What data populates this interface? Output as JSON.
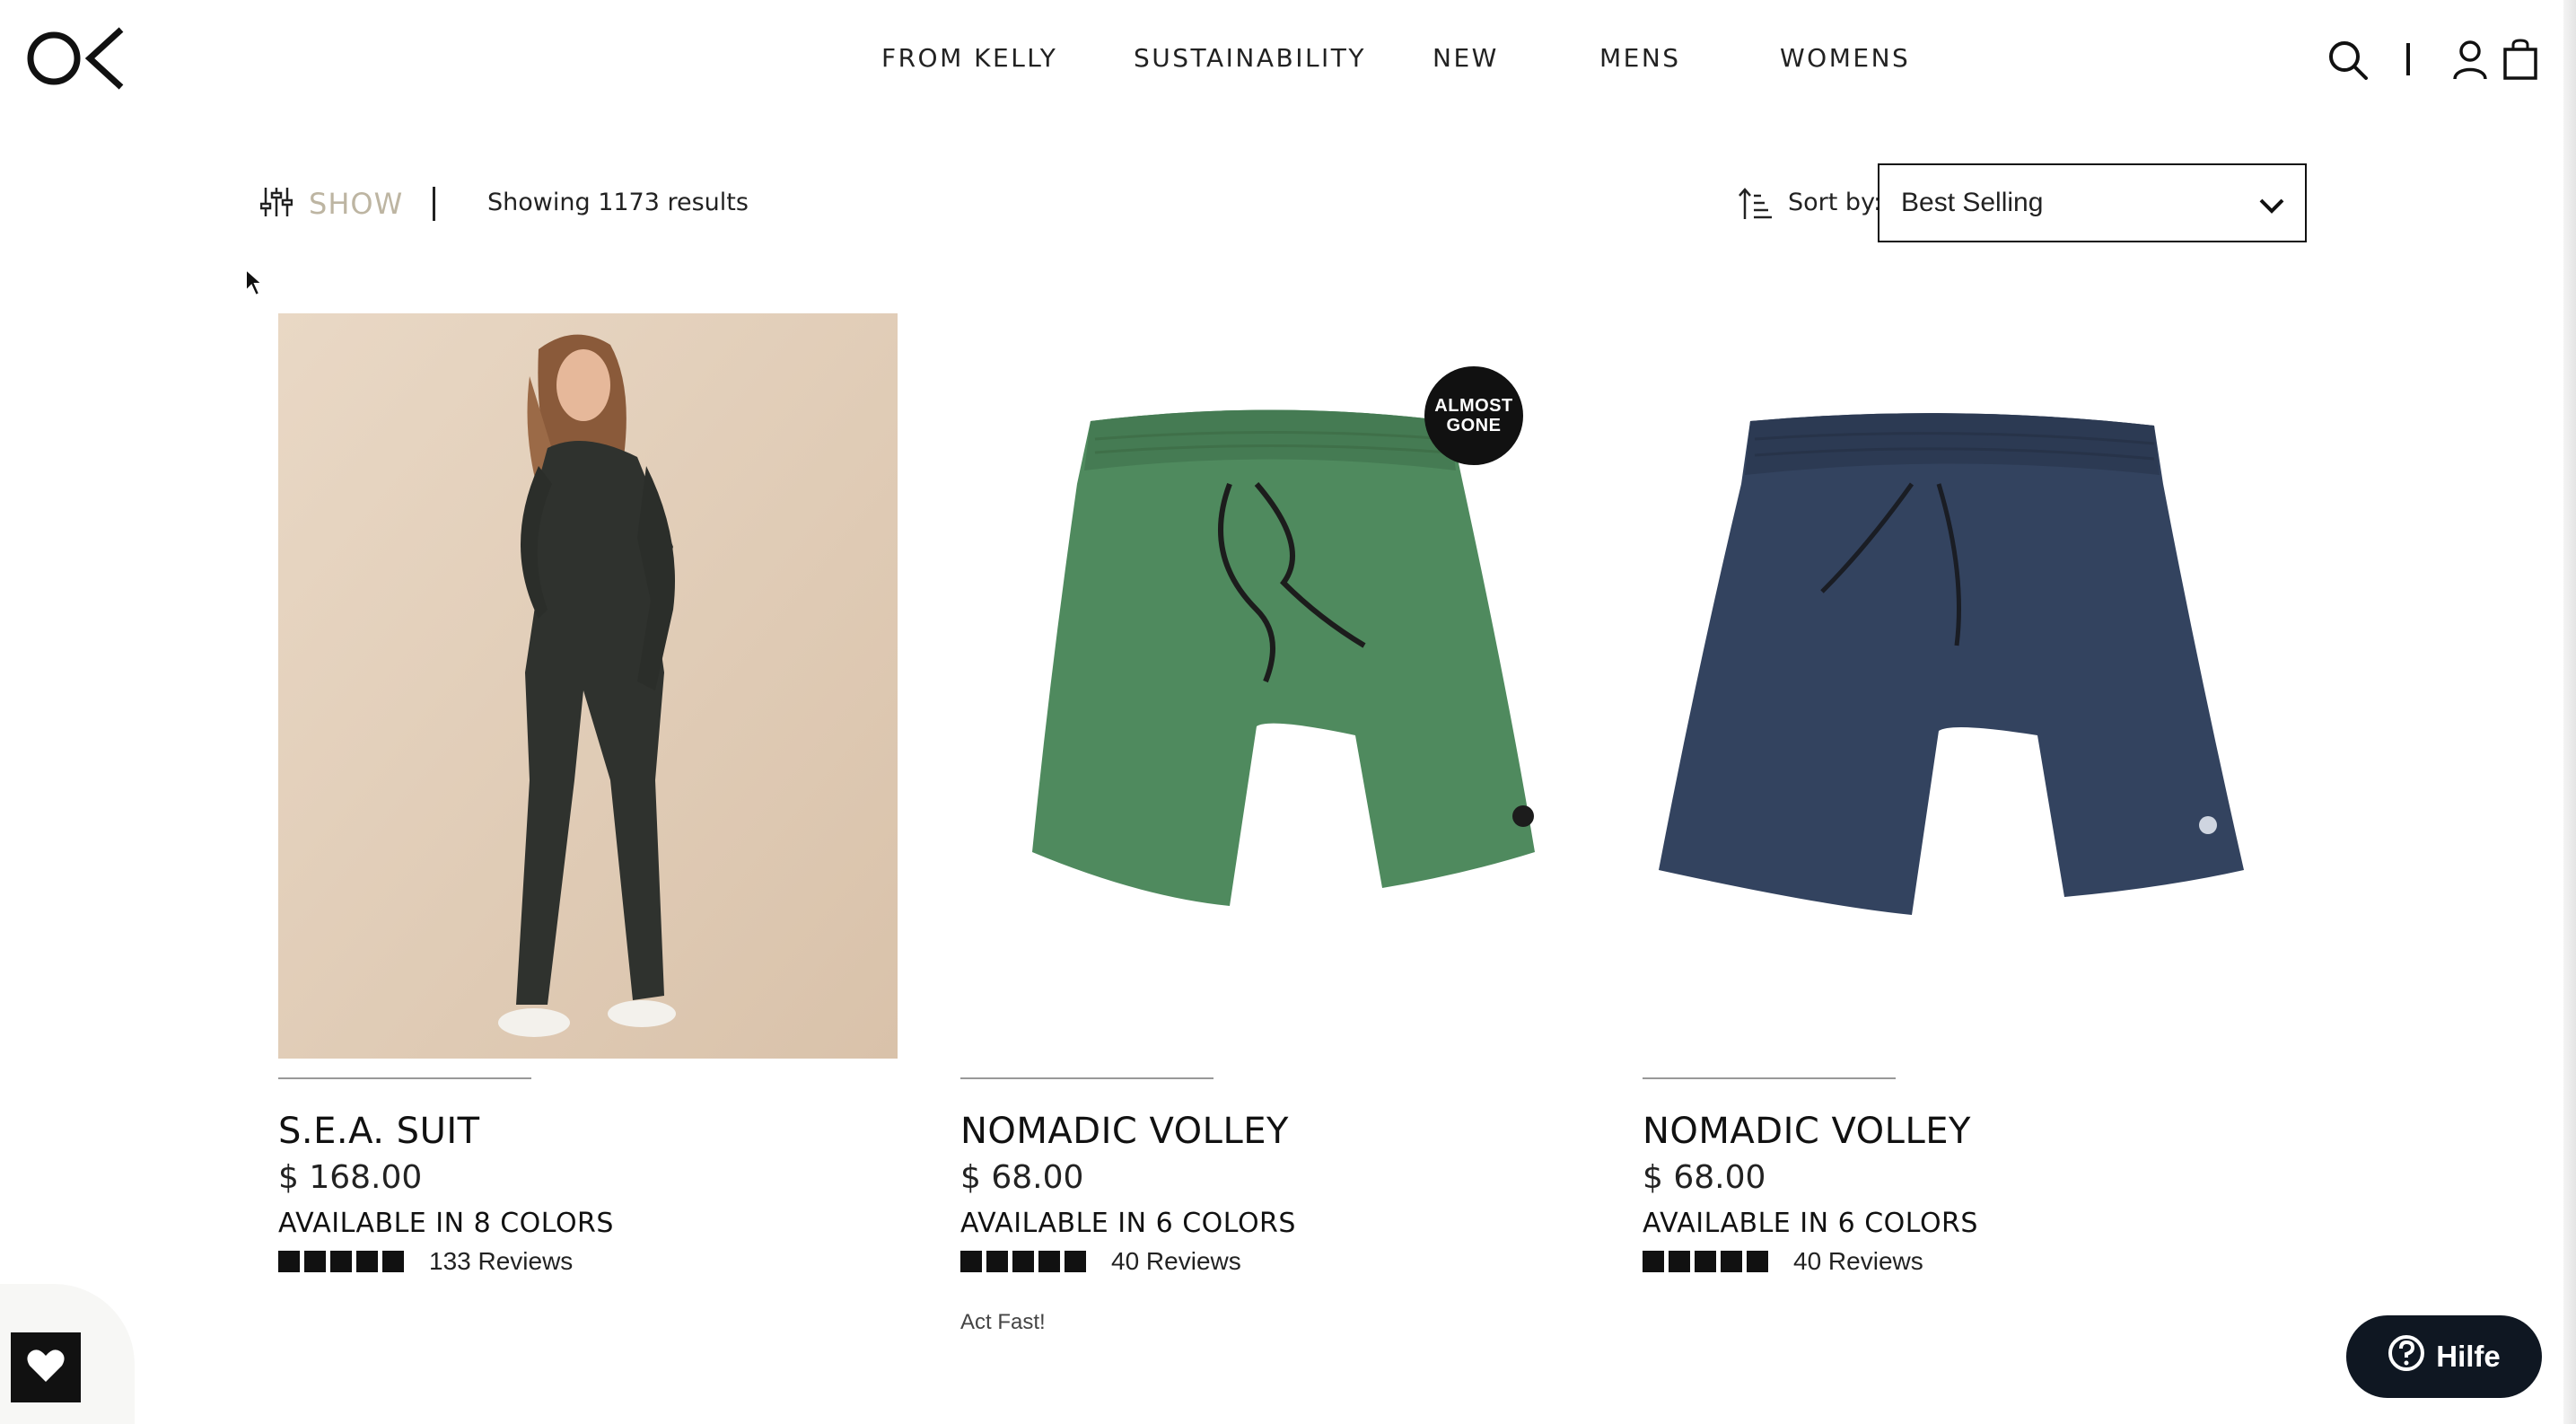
{
  "header": {
    "logo_alt": "OK",
    "nav": [
      {
        "label": "FROM KELLY"
      },
      {
        "label": "SUSTAINABILITY"
      },
      {
        "label": "NEW"
      },
      {
        "label": "MENS"
      },
      {
        "label": "WOMENS"
      }
    ],
    "icons": [
      "search-icon",
      "divider",
      "account-icon",
      "cart-icon"
    ]
  },
  "toolbar": {
    "show_label": "SHOW",
    "results_text": "Showing 1173 results",
    "sort_label": "Sort by:",
    "sort_value": "Best Selling"
  },
  "products": [
    {
      "name": "S.E.A. SUIT",
      "price": "$ 168.00",
      "colors": "AVAILABLE IN 8 COLORS",
      "rating": 5,
      "reviews": "133 Reviews",
      "note": "",
      "badge": ""
    },
    {
      "name": "NOMADIC VOLLEY",
      "price": "$ 68.00",
      "colors": "AVAILABLE IN 6 COLORS",
      "rating": 5,
      "reviews": "40 Reviews",
      "note": "Act Fast!",
      "badge": "ALMOST GONE"
    },
    {
      "name": "NOMADIC VOLLEY",
      "price": "$ 68.00",
      "colors": "AVAILABLE IN 6 COLORS",
      "rating": 5,
      "reviews": "40 Reviews",
      "note": "",
      "badge": ""
    }
  ],
  "help": {
    "label": "Hilfe"
  },
  "colors": {
    "show_text": "#bdb5a2",
    "help_bg": "#0f1722",
    "green_shorts": "#4f8a5e",
    "navy_shorts": "#33435f",
    "photo_bg": "#e8d6c3"
  }
}
